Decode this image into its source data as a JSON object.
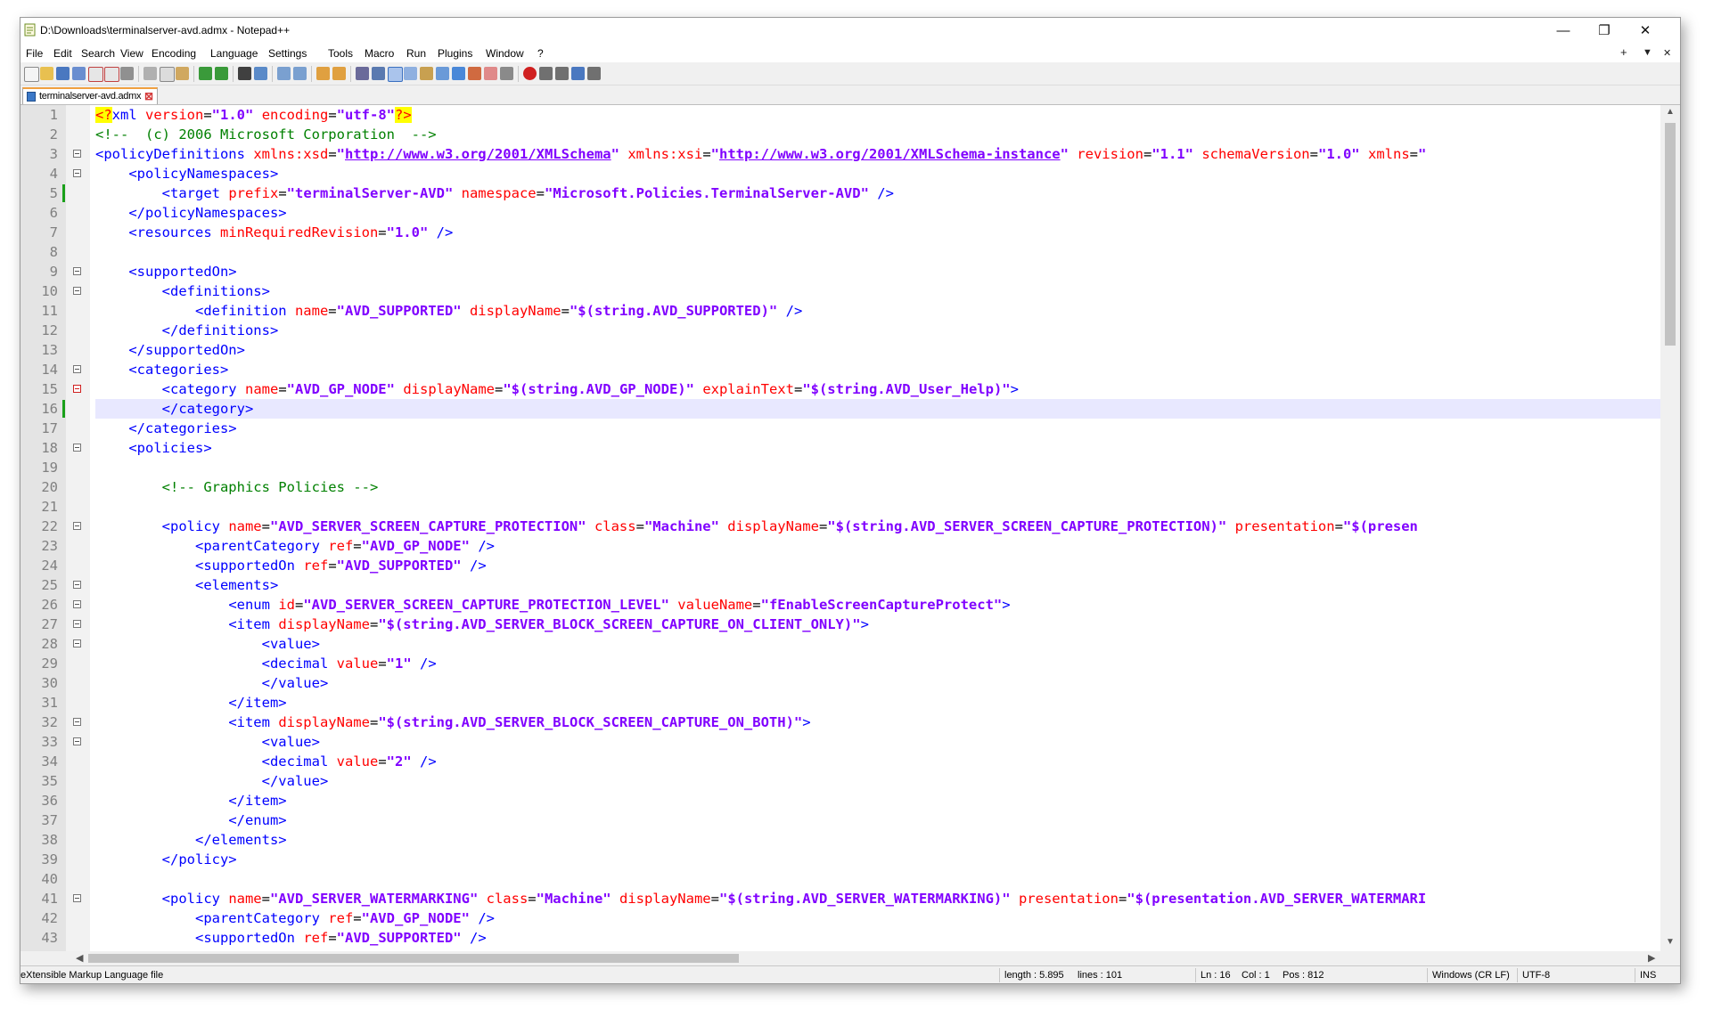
{
  "window": {
    "title": "D:\\Downloads\\terminalserver-avd.admx - Notepad++",
    "minimize": "—",
    "restore": "❐",
    "close": "✕"
  },
  "menu": {
    "items": [
      "File",
      "Edit",
      "Search",
      "View",
      "Encoding",
      "Language",
      "Settings",
      "Tools",
      "Macro",
      "Run",
      "Plugins",
      "Window",
      "?"
    ],
    "right_controls": [
      "+",
      "▼",
      "✕"
    ]
  },
  "tab": {
    "label": "terminalserver-avd.admx",
    "close": "⊠"
  },
  "editor": {
    "current_line": 16,
    "line_numbers": [
      1,
      2,
      3,
      4,
      5,
      6,
      7,
      8,
      9,
      10,
      11,
      12,
      13,
      14,
      15,
      16,
      17,
      18,
      19,
      20,
      21,
      22,
      23,
      24,
      25,
      26,
      27,
      28,
      29,
      30,
      31,
      32,
      33,
      34,
      35,
      36,
      37,
      38,
      39,
      40,
      41,
      42,
      43
    ],
    "lines": [
      [
        [
          "pi",
          "<?"
        ],
        [
          "t",
          "xml "
        ],
        [
          "a",
          "version"
        ],
        [
          "p",
          "="
        ],
        [
          "v",
          "\"1.0\""
        ],
        [
          "p",
          " "
        ],
        [
          "a",
          "encoding"
        ],
        [
          "p",
          "="
        ],
        [
          "v",
          "\"utf-8\""
        ],
        [
          "pi",
          "?>"
        ]
      ],
      [
        [
          "c",
          "<!--  (c) 2006 Microsoft Corporation  -->"
        ]
      ],
      [
        [
          "t",
          "<policyDefinitions "
        ],
        [
          "a",
          "xmlns:xsd"
        ],
        [
          "p",
          "="
        ],
        [
          "v",
          "\""
        ],
        [
          "u",
          "http://www.w3.org/2001/XMLSchema"
        ],
        [
          "v",
          "\""
        ],
        [
          "p",
          " "
        ],
        [
          "a",
          "xmlns:xsi"
        ],
        [
          "p",
          "="
        ],
        [
          "v",
          "\""
        ],
        [
          "u",
          "http://www.w3.org/2001/XMLSchema-instance"
        ],
        [
          "v",
          "\""
        ],
        [
          "p",
          " "
        ],
        [
          "a",
          "revision"
        ],
        [
          "p",
          "="
        ],
        [
          "v",
          "\"1.1\""
        ],
        [
          "p",
          " "
        ],
        [
          "a",
          "schemaVersion"
        ],
        [
          "p",
          "="
        ],
        [
          "v",
          "\"1.0\""
        ],
        [
          "p",
          " "
        ],
        [
          "a",
          "xmlns"
        ],
        [
          "p",
          "="
        ],
        [
          "v",
          "\""
        ]
      ],
      [
        [
          "p",
          "    "
        ],
        [
          "t",
          "<policyNamespaces>"
        ]
      ],
      [
        [
          "p",
          "        "
        ],
        [
          "t",
          "<target "
        ],
        [
          "a",
          "prefix"
        ],
        [
          "p",
          "="
        ],
        [
          "v",
          "\"terminalServer-AVD\""
        ],
        [
          "p",
          " "
        ],
        [
          "a",
          "namespace"
        ],
        [
          "p",
          "="
        ],
        [
          "v",
          "\"Microsoft.Policies.TerminalServer-AVD\""
        ],
        [
          "p",
          " "
        ],
        [
          "t",
          "/>"
        ]
      ],
      [
        [
          "p",
          "    "
        ],
        [
          "t",
          "</policyNamespaces>"
        ]
      ],
      [
        [
          "p",
          "    "
        ],
        [
          "t",
          "<resources "
        ],
        [
          "a",
          "minRequiredRevision"
        ],
        [
          "p",
          "="
        ],
        [
          "v",
          "\"1.0\""
        ],
        [
          "p",
          " "
        ],
        [
          "t",
          "/>"
        ]
      ],
      [],
      [
        [
          "p",
          "    "
        ],
        [
          "t",
          "<supportedOn>"
        ]
      ],
      [
        [
          "p",
          "        "
        ],
        [
          "t",
          "<definitions>"
        ]
      ],
      [
        [
          "p",
          "            "
        ],
        [
          "t",
          "<definition "
        ],
        [
          "a",
          "name"
        ],
        [
          "p",
          "="
        ],
        [
          "v",
          "\"AVD_SUPPORTED\""
        ],
        [
          "p",
          " "
        ],
        [
          "a",
          "displayName"
        ],
        [
          "p",
          "="
        ],
        [
          "v",
          "\"$(string.AVD_SUPPORTED)\""
        ],
        [
          "p",
          " "
        ],
        [
          "t",
          "/>"
        ]
      ],
      [
        [
          "p",
          "        "
        ],
        [
          "t",
          "</definitions>"
        ]
      ],
      [
        [
          "p",
          "    "
        ],
        [
          "t",
          "</supportedOn>"
        ]
      ],
      [
        [
          "p",
          "    "
        ],
        [
          "t",
          "<categories>"
        ]
      ],
      [
        [
          "p",
          "        "
        ],
        [
          "t",
          "<category "
        ],
        [
          "a",
          "name"
        ],
        [
          "p",
          "="
        ],
        [
          "v",
          "\"AVD_GP_NODE\""
        ],
        [
          "p",
          " "
        ],
        [
          "a",
          "displayName"
        ],
        [
          "p",
          "="
        ],
        [
          "v",
          "\"$(string.AVD_GP_NODE)\""
        ],
        [
          "p",
          " "
        ],
        [
          "a",
          "explainText"
        ],
        [
          "p",
          "="
        ],
        [
          "v",
          "\"$(string.AVD_User_Help)\""
        ],
        [
          "t",
          ">"
        ]
      ],
      [
        [
          "p",
          "        "
        ],
        [
          "t",
          "</category>"
        ]
      ],
      [
        [
          "p",
          "    "
        ],
        [
          "t",
          "</categories>"
        ]
      ],
      [
        [
          "p",
          "    "
        ],
        [
          "t",
          "<policies>"
        ]
      ],
      [],
      [
        [
          "p",
          "        "
        ],
        [
          "c",
          "<!-- Graphics Policies -->"
        ]
      ],
      [],
      [
        [
          "p",
          "        "
        ],
        [
          "t",
          "<policy "
        ],
        [
          "a",
          "name"
        ],
        [
          "p",
          "="
        ],
        [
          "v",
          "\"AVD_SERVER_SCREEN_CAPTURE_PROTECTION\""
        ],
        [
          "p",
          " "
        ],
        [
          "a",
          "class"
        ],
        [
          "p",
          "="
        ],
        [
          "v",
          "\"Machine\""
        ],
        [
          "p",
          " "
        ],
        [
          "a",
          "displayName"
        ],
        [
          "p",
          "="
        ],
        [
          "v",
          "\"$(string.AVD_SERVER_SCREEN_CAPTURE_PROTECTION)\""
        ],
        [
          "p",
          " "
        ],
        [
          "a",
          "presentation"
        ],
        [
          "p",
          "="
        ],
        [
          "v",
          "\"$(presen"
        ]
      ],
      [
        [
          "p",
          "            "
        ],
        [
          "t",
          "<parentCategory "
        ],
        [
          "a",
          "ref"
        ],
        [
          "p",
          "="
        ],
        [
          "v",
          "\"AVD_GP_NODE\""
        ],
        [
          "p",
          " "
        ],
        [
          "t",
          "/>"
        ]
      ],
      [
        [
          "p",
          "            "
        ],
        [
          "t",
          "<supportedOn "
        ],
        [
          "a",
          "ref"
        ],
        [
          "p",
          "="
        ],
        [
          "v",
          "\"AVD_SUPPORTED\""
        ],
        [
          "p",
          " "
        ],
        [
          "t",
          "/>"
        ]
      ],
      [
        [
          "p",
          "            "
        ],
        [
          "t",
          "<elements>"
        ]
      ],
      [
        [
          "p",
          "                "
        ],
        [
          "t",
          "<enum "
        ],
        [
          "a",
          "id"
        ],
        [
          "p",
          "="
        ],
        [
          "v",
          "\"AVD_SERVER_SCREEN_CAPTURE_PROTECTION_LEVEL\""
        ],
        [
          "p",
          " "
        ],
        [
          "a",
          "valueName"
        ],
        [
          "p",
          "="
        ],
        [
          "v",
          "\"fEnableScreenCaptureProtect\""
        ],
        [
          "t",
          ">"
        ]
      ],
      [
        [
          "p",
          "                "
        ],
        [
          "t",
          "<item "
        ],
        [
          "a",
          "displayName"
        ],
        [
          "p",
          "="
        ],
        [
          "v",
          "\"$(string.AVD_SERVER_BLOCK_SCREEN_CAPTURE_ON_CLIENT_ONLY)\""
        ],
        [
          "t",
          ">"
        ]
      ],
      [
        [
          "p",
          "                    "
        ],
        [
          "t",
          "<value>"
        ]
      ],
      [
        [
          "p",
          "                    "
        ],
        [
          "t",
          "<decimal "
        ],
        [
          "a",
          "value"
        ],
        [
          "p",
          "="
        ],
        [
          "v",
          "\"1\""
        ],
        [
          "p",
          " "
        ],
        [
          "t",
          "/>"
        ]
      ],
      [
        [
          "p",
          "                    "
        ],
        [
          "t",
          "</value>"
        ]
      ],
      [
        [
          "p",
          "                "
        ],
        [
          "t",
          "</item>"
        ]
      ],
      [
        [
          "p",
          "                "
        ],
        [
          "t",
          "<item "
        ],
        [
          "a",
          "displayName"
        ],
        [
          "p",
          "="
        ],
        [
          "v",
          "\"$(string.AVD_SERVER_BLOCK_SCREEN_CAPTURE_ON_BOTH)\""
        ],
        [
          "t",
          ">"
        ]
      ],
      [
        [
          "p",
          "                    "
        ],
        [
          "t",
          "<value>"
        ]
      ],
      [
        [
          "p",
          "                    "
        ],
        [
          "t",
          "<decimal "
        ],
        [
          "a",
          "value"
        ],
        [
          "p",
          "="
        ],
        [
          "v",
          "\"2\""
        ],
        [
          "p",
          " "
        ],
        [
          "t",
          "/>"
        ]
      ],
      [
        [
          "p",
          "                    "
        ],
        [
          "t",
          "</value>"
        ]
      ],
      [
        [
          "p",
          "                "
        ],
        [
          "t",
          "</item>"
        ]
      ],
      [
        [
          "p",
          "                "
        ],
        [
          "t",
          "</enum>"
        ]
      ],
      [
        [
          "p",
          "            "
        ],
        [
          "t",
          "</elements>"
        ]
      ],
      [
        [
          "p",
          "        "
        ],
        [
          "t",
          "</policy>"
        ]
      ],
      [],
      [
        [
          "p",
          "        "
        ],
        [
          "t",
          "<policy "
        ],
        [
          "a",
          "name"
        ],
        [
          "p",
          "="
        ],
        [
          "v",
          "\"AVD_SERVER_WATERMARKING\""
        ],
        [
          "p",
          " "
        ],
        [
          "a",
          "class"
        ],
        [
          "p",
          "="
        ],
        [
          "v",
          "\"Machine\""
        ],
        [
          "p",
          " "
        ],
        [
          "a",
          "displayName"
        ],
        [
          "p",
          "="
        ],
        [
          "v",
          "\"$(string.AVD_SERVER_WATERMARKING)\""
        ],
        [
          "p",
          " "
        ],
        [
          "a",
          "presentation"
        ],
        [
          "p",
          "="
        ],
        [
          "v",
          "\"$(presentation.AVD_SERVER_WATERMARI"
        ]
      ],
      [
        [
          "p",
          "            "
        ],
        [
          "t",
          "<parentCategory "
        ],
        [
          "a",
          "ref"
        ],
        [
          "p",
          "="
        ],
        [
          "v",
          "\"AVD_GP_NODE\""
        ],
        [
          "p",
          " "
        ],
        [
          "t",
          "/>"
        ]
      ],
      [
        [
          "p",
          "            "
        ],
        [
          "t",
          "<supportedOn "
        ],
        [
          "a",
          "ref"
        ],
        [
          "p",
          "="
        ],
        [
          "v",
          "\"AVD_SUPPORTED\""
        ],
        [
          "p",
          " "
        ],
        [
          "t",
          "/>"
        ]
      ]
    ],
    "fold_markers": [
      3,
      4,
      9,
      10,
      14,
      15,
      18,
      22,
      25,
      26,
      27,
      28,
      32,
      33,
      41
    ],
    "red_fold_markers": [
      15
    ],
    "changed_lines": [
      5,
      16
    ],
    "colors": {
      "tag": "#0000ff",
      "attribute": "#ff0000",
      "value": "#8000ff",
      "comment": "#008000"
    }
  },
  "statusbar": {
    "file_type": "eXtensible Markup Language file",
    "length": "length : 5.895",
    "lines": "lines : 101",
    "ln": "Ln : 16",
    "col": "Col : 1",
    "pos": "Pos : 812",
    "eol": "Windows (CR LF)",
    "encoding": "UTF-8",
    "mode": "INS"
  }
}
